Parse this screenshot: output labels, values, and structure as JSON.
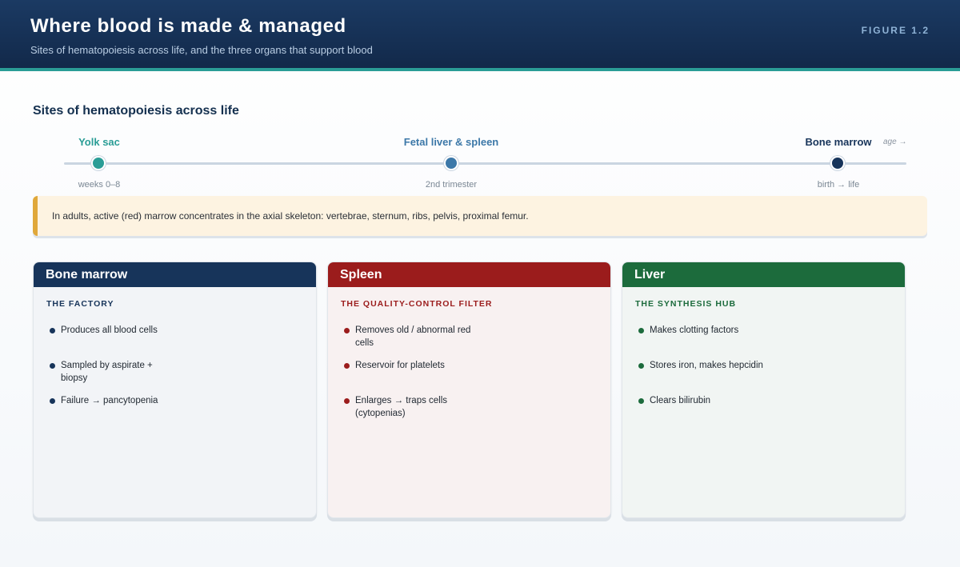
{
  "header": {
    "title": "Where blood is made & managed",
    "subtitle": "Sites of hematopoiesis across life, and the three organs that support blood",
    "figure_label": "FIGURE 1.2"
  },
  "timeline": {
    "section_title": "Sites of hematopoiesis across life",
    "axis_label": "age →",
    "stages": [
      {
        "name": "Yolk sac",
        "period": "weeks 0–8",
        "color": "#2a9d96"
      },
      {
        "name": "Fetal liver & spleen",
        "period": "2nd trimester",
        "color": "#3c78a8"
      },
      {
        "name": "Bone marrow",
        "period": "birth → life",
        "color": "#17345a"
      }
    ]
  },
  "note": {
    "text": "In adults, active (red) marrow concentrates in the axial skeleton: vertebrae, sternum, ribs, pelvis, proximal femur."
  },
  "organs": [
    {
      "name": "Bone marrow",
      "role": "THE FACTORY",
      "accent": "#17345a",
      "tint": "#f2f4f7",
      "bullets": [
        "Produces all blood cells",
        "Sampled by aspirate + biopsy",
        "Failure → pancytopenia"
      ]
    },
    {
      "name": "Spleen",
      "role": "THE QUALITY-CONTROL FILTER",
      "accent": "#9b1c1c",
      "tint": "#f8f1f1",
      "bullets": [
        "Removes old / abnormal red cells",
        "Reservoir for platelets",
        "Enlarges → traps cells (cytopenias)"
      ]
    },
    {
      "name": "Liver",
      "role": "THE SYNTHESIS HUB",
      "accent": "#1c6b3c",
      "tint": "#f1f5f3",
      "bullets": [
        "Makes clotting factors",
        "Stores iron, makes hepcidin",
        "Clears bilirubin"
      ]
    }
  ]
}
